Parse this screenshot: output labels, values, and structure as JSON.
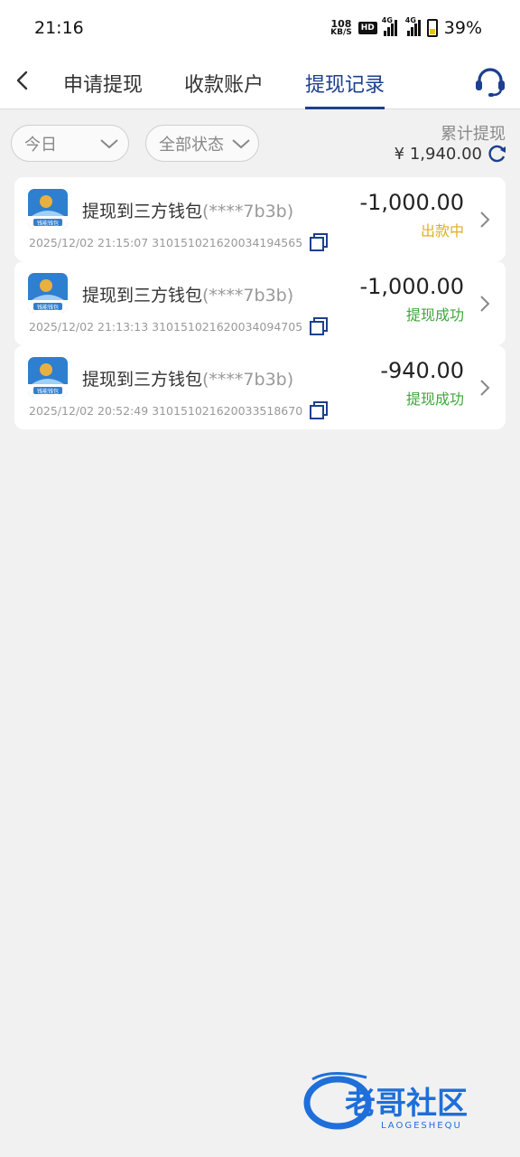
{
  "status_bar": {
    "time": "21:16",
    "net_speed_value": "108",
    "net_speed_unit": "KB/S",
    "hd_label": "HD",
    "sim1_label": "4G",
    "sim2_label": "4G",
    "battery": "39%"
  },
  "nav": {
    "tabs": [
      {
        "label": "申请提现"
      },
      {
        "label": "收款账户"
      },
      {
        "label": "提现记录",
        "active": true
      }
    ]
  },
  "filters": {
    "date": "今日",
    "status": "全部状态"
  },
  "summary": {
    "label": "累计提现",
    "value": "¥ 1,940.00"
  },
  "records": [
    {
      "title": "提现到三方钱包",
      "account": "(****7b3b)",
      "meta": "2025/12/02 21:15:07 310151021620034194565",
      "amount": "-1,000.00",
      "status": "出款中",
      "status_color": "#e0b020"
    },
    {
      "title": "提现到三方钱包",
      "account": "(****7b3b)",
      "meta": "2025/12/02 21:13:13 310151021620034094705",
      "amount": "-1,000.00",
      "status": "提现成功",
      "status_color": "#3fa63a"
    },
    {
      "title": "提现到三方钱包",
      "account": "(****7b3b)",
      "meta": "2025/12/02 20:52:49 310151021620033518670",
      "amount": "-940.00",
      "status": "提现成功",
      "status_color": "#3fa63a"
    }
  ],
  "wallet_logo_text": "钱能钱包",
  "watermark": {
    "title": "老哥社区",
    "subtitle": "LAOGESHEQU"
  },
  "colors": {
    "accent": "#1c3f8f",
    "background": "#f1f1f1"
  }
}
